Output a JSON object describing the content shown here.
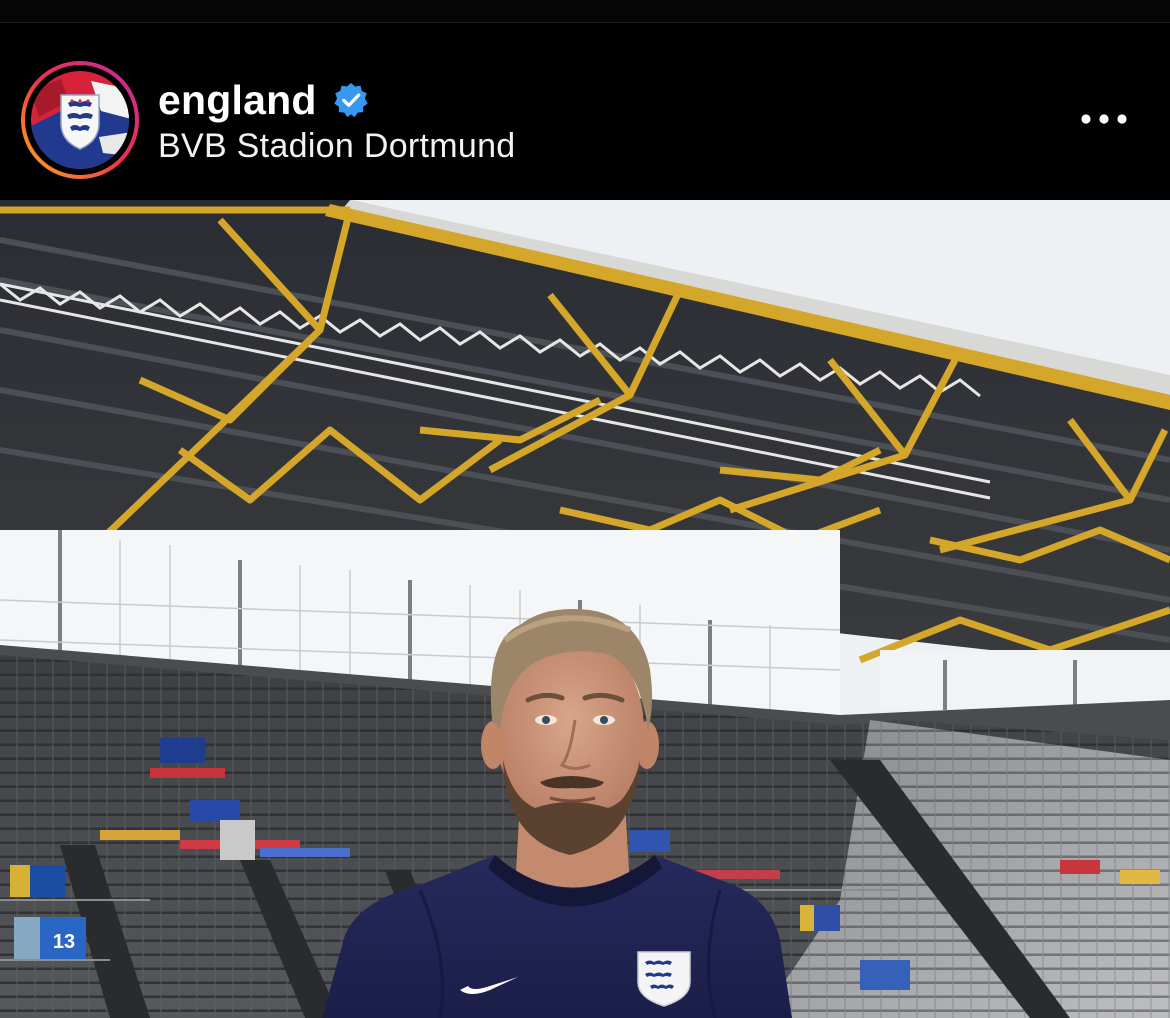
{
  "post_header": {
    "username": "england",
    "location": "BVB Stadion Dortmund"
  },
  "icons": {
    "avatar": "england-crest-avatar",
    "verified": "verified-badge-icon",
    "more": "more-options-icon"
  },
  "colors": {
    "verified_blue": "#3897f0",
    "avatar_ring_start": "#f58529",
    "avatar_ring_end": "#dd2a7b",
    "shirt_navy": "#1f2350",
    "stadium_steel": "#d4a62a"
  },
  "photo": {
    "stand_number": "13"
  }
}
